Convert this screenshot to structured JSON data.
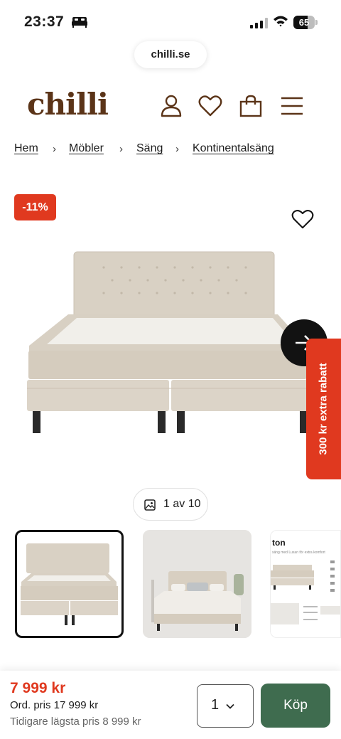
{
  "status_bar": {
    "time": "23:37",
    "battery": "65",
    "battery_level": 0.65
  },
  "browser": {
    "url": "chilli.se"
  },
  "header": {
    "logo": "chilli"
  },
  "breadcrumb": {
    "items": [
      "Hem",
      "Möbler",
      "Säng",
      "Kontinentalsäng"
    ],
    "separator": "›"
  },
  "product": {
    "discount_badge": "-11%",
    "promo_tab": "300 kr extra rabatt",
    "image_counter": "1 av 10",
    "thumb3_title": "ton",
    "thumb3_subtitle": "säng med Luxan för extra komfort"
  },
  "purchase": {
    "price": "7 999 kr",
    "ordinary_price": "Ord. pris 17 999 kr",
    "lowest_price": "Tidigare lägsta pris 8 999 kr",
    "quantity": "1",
    "buy_label": "Köp"
  },
  "colors": {
    "accent_red": "#e0391f",
    "buy_green": "#3f6c4f",
    "logo_brown": "#5b3418"
  },
  "icons": [
    "bed-icon",
    "signal-icon",
    "wifi-icon",
    "battery-icon",
    "user-icon",
    "heart-icon",
    "bag-icon",
    "menu-icon",
    "arrow-right-icon",
    "image-icon",
    "chevron-down-icon"
  ]
}
